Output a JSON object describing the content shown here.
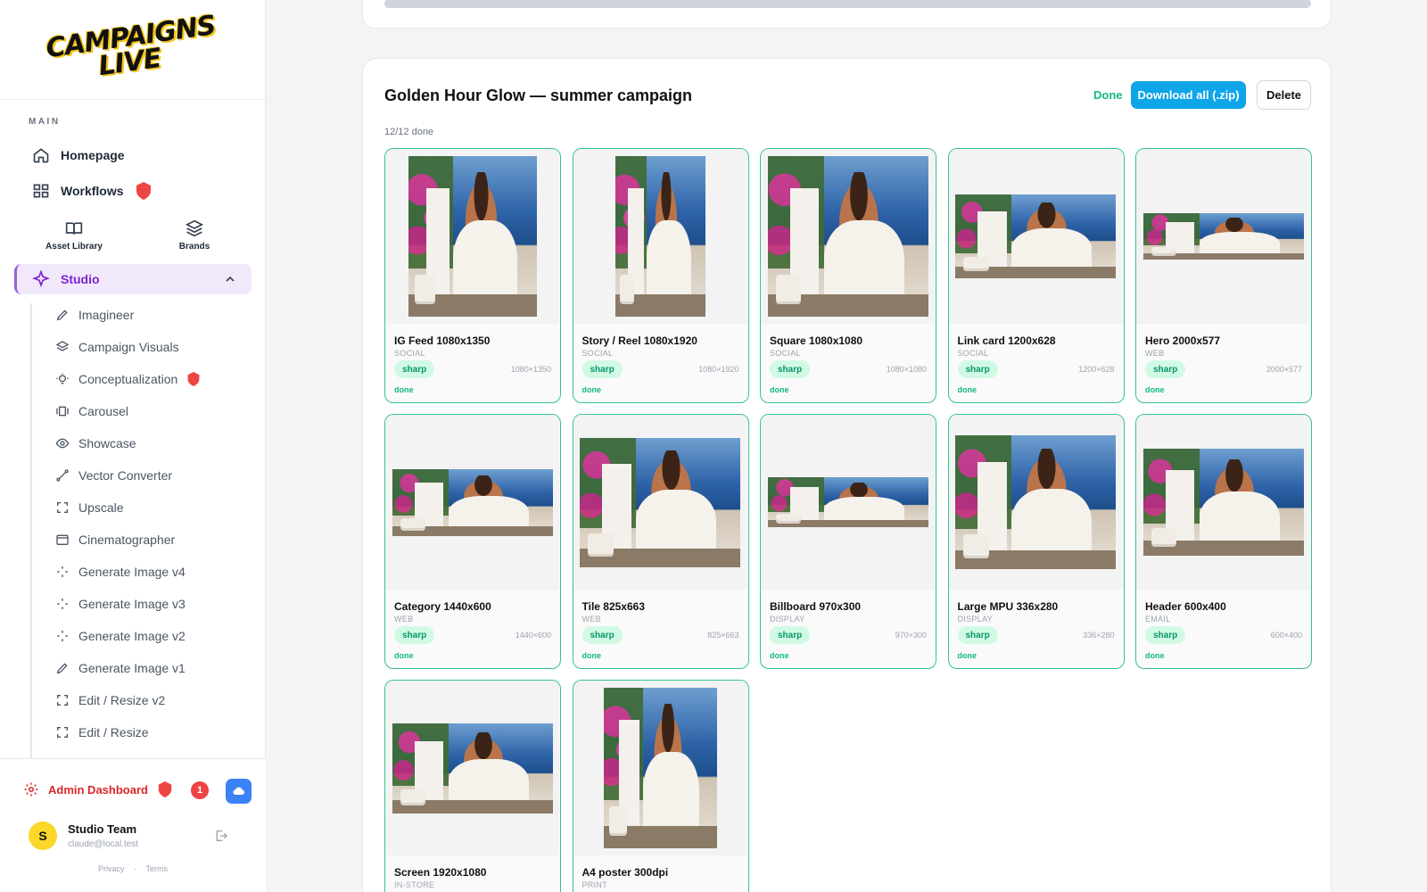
{
  "brand": {
    "logo_line1": "CAMPAIGNS",
    "logo_line2": "LIVE"
  },
  "sidebar": {
    "section_label": "MAIN",
    "homepage": "Homepage",
    "workflows": "Workflows",
    "asset_library": "Asset Library",
    "brands": "Brands",
    "studio": "Studio",
    "studio_items": [
      {
        "label": "Imagineer",
        "icon": "pencil-icon"
      },
      {
        "label": "Campaign Visuals",
        "icon": "layers-icon"
      },
      {
        "label": "Conceptualization",
        "icon": "lightbulb-icon",
        "restricted": true
      },
      {
        "label": "Carousel",
        "icon": "carousel-icon"
      },
      {
        "label": "Showcase",
        "icon": "eye-icon"
      },
      {
        "label": "Vector Converter",
        "icon": "vector-icon"
      },
      {
        "label": "Upscale",
        "icon": "expand-icon"
      },
      {
        "label": "Cinematographer",
        "icon": "film-icon"
      },
      {
        "label": "Generate Image v4",
        "icon": "sparkles-icon"
      },
      {
        "label": "Generate Image v3",
        "icon": "sparkles-icon"
      },
      {
        "label": "Generate Image v2",
        "icon": "sparkles-icon"
      },
      {
        "label": "Generate Image v1",
        "icon": "pencil-icon"
      },
      {
        "label": "Edit / Resize v2",
        "icon": "expand-icon"
      },
      {
        "label": "Edit / Resize",
        "icon": "expand-icon"
      }
    ],
    "admin_dashboard": "Admin Dashboard",
    "notification_count": "1",
    "user": {
      "initial": "S",
      "name": "Studio Team",
      "email": "claude@local.test"
    },
    "footer": {
      "privacy": "Privacy",
      "separator": "·",
      "terms": "Terms"
    }
  },
  "campaign": {
    "title": "Golden Hour Glow — summer campaign",
    "progress": "12/12 done",
    "done_label": "Done",
    "download_label": "Download all (.zip)",
    "delete_label": "Delete",
    "tiles": [
      {
        "name": "IG Feed 1080x1350",
        "category": "SOCIAL",
        "pill": "sharp",
        "dims": "1080×1350",
        "status": "done"
      },
      {
        "name": "Story / Reel 1080x1920",
        "category": "SOCIAL",
        "pill": "sharp",
        "dims": "1080×1920",
        "status": "done"
      },
      {
        "name": "Square 1080x1080",
        "category": "SOCIAL",
        "pill": "sharp",
        "dims": "1080×1080",
        "status": "done"
      },
      {
        "name": "Link card 1200x628",
        "category": "SOCIAL",
        "pill": "sharp",
        "dims": "1200×628",
        "status": "done"
      },
      {
        "name": "Hero 2000x577",
        "category": "WEB",
        "pill": "sharp",
        "dims": "2000×577",
        "status": "done"
      },
      {
        "name": "Category 1440x600",
        "category": "WEB",
        "pill": "sharp",
        "dims": "1440×600",
        "status": "done"
      },
      {
        "name": "Tile 825x663",
        "category": "WEB",
        "pill": "sharp",
        "dims": "825×663",
        "status": "done"
      },
      {
        "name": "Billboard 970x300",
        "category": "DISPLAY",
        "pill": "sharp",
        "dims": "970×300",
        "status": "done"
      },
      {
        "name": "Large MPU 336x280",
        "category": "DISPLAY",
        "pill": "sharp",
        "dims": "336×280",
        "status": "done"
      },
      {
        "name": "Header 600x400",
        "category": "EMAIL",
        "pill": "sharp",
        "dims": "600×400",
        "status": "done"
      },
      {
        "name": "Screen 1920x1080",
        "category": "IN-STORE",
        "pill": "",
        "dims": "",
        "status": ""
      },
      {
        "name": "A4 poster 300dpi",
        "category": "PRINT",
        "pill": "",
        "dims": "",
        "status": ""
      }
    ]
  },
  "colors": {
    "accent": "#0ea5e9",
    "success": "#10b981",
    "studio": "#7e22ce",
    "danger": "#dc2626"
  }
}
